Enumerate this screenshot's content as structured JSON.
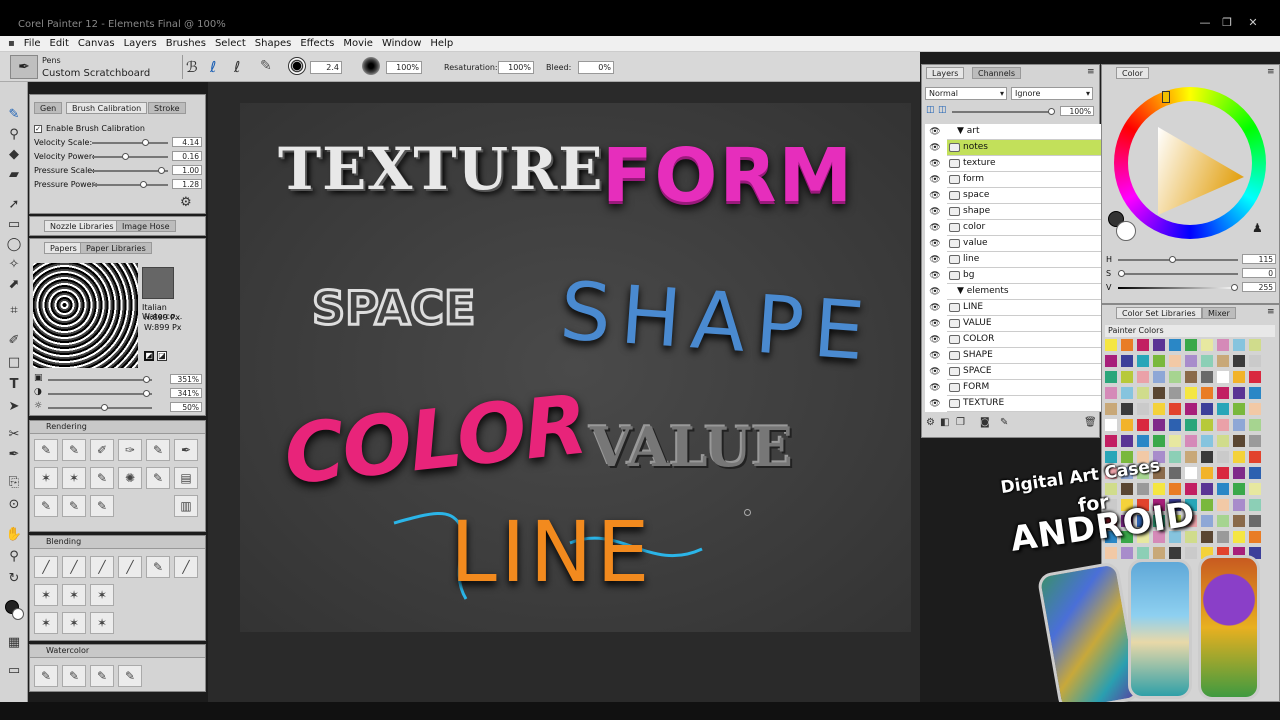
{
  "window": {
    "title": "Corel Painter 12 - Elements Final @ 100%",
    "min": "—",
    "max": "❐",
    "close": "✕"
  },
  "menu": [
    "File",
    "Edit",
    "Canvas",
    "Layers",
    "Brushes",
    "Select",
    "Shapes",
    "Effects",
    "Movie",
    "Window",
    "Help"
  ],
  "brush_selector": {
    "category": "Pens",
    "variant": "Custom Scratchboard"
  },
  "propbar": {
    "size": "2.4",
    "opacity": "100%",
    "resaturation_label": "Resaturation:",
    "resaturation": "100%",
    "bleed_label": "Bleed:",
    "bleed": "0%"
  },
  "brush_calibration": {
    "tabs": [
      "Gen",
      "Brush Calibration",
      "Stroke"
    ],
    "enable": "Enable Brush Calibration",
    "rows": [
      {
        "label": "Velocity Scale:",
        "value": "4.14",
        "pos": 0.72
      },
      {
        "label": "Velocity Power:",
        "value": "0.16",
        "pos": 0.43
      },
      {
        "label": "Pressure Scale:",
        "value": "1.00",
        "pos": 0.95
      },
      {
        "label": "Pressure Power:",
        "value": "1.28",
        "pos": 0.7
      }
    ]
  },
  "nozzle": {
    "tabs": [
      "Nozzle Libraries",
      "Image Hose"
    ]
  },
  "papers": {
    "tabs": [
      "Papers",
      "Paper Libraries"
    ],
    "name": "Italian Waterco...",
    "height": "H:899 Px",
    "width": "W:899 Px",
    "sliders": [
      {
        "value": "351%",
        "pos": 0.98
      },
      {
        "value": "341%",
        "pos": 0.98
      },
      {
        "value": "50%",
        "pos": 0.55
      }
    ]
  },
  "rendering": {
    "title": "Rendering"
  },
  "blending": {
    "title": "Blending"
  },
  "watercolor": {
    "title": "Watercolor"
  },
  "canvas_words": [
    "TEXTURE",
    "FORM",
    "SPACE",
    "SHAPE",
    "COLOR",
    "VALUE",
    "LINE"
  ],
  "layers": {
    "tabs": [
      "Layers",
      "Channels"
    ],
    "composite": "Normal",
    "depth": "Ignore",
    "opacity": "100%",
    "items": [
      {
        "name": "art",
        "group": true,
        "selected": false
      },
      {
        "name": "notes",
        "group": false,
        "selected": true
      },
      {
        "name": "texture",
        "group": false,
        "selected": false
      },
      {
        "name": "form",
        "group": false,
        "selected": false
      },
      {
        "name": "space",
        "group": false,
        "selected": false
      },
      {
        "name": "shape",
        "group": false,
        "selected": false
      },
      {
        "name": "color",
        "group": false,
        "selected": false
      },
      {
        "name": "value",
        "group": false,
        "selected": false
      },
      {
        "name": "line",
        "group": false,
        "selected": false
      },
      {
        "name": "bg",
        "group": false,
        "selected": false
      },
      {
        "name": "elements",
        "group": true,
        "selected": false
      },
      {
        "name": "LINE",
        "group": false,
        "selected": false
      },
      {
        "name": "VALUE",
        "group": false,
        "selected": false
      },
      {
        "name": "COLOR",
        "group": false,
        "selected": false
      },
      {
        "name": "SHAPE",
        "group": false,
        "selected": false
      },
      {
        "name": "SPACE",
        "group": false,
        "selected": false
      },
      {
        "name": "FORM",
        "group": false,
        "selected": false
      },
      {
        "name": "TEXTURE",
        "group": false,
        "selected": false
      }
    ]
  },
  "color": {
    "tab": "Color",
    "h": {
      "label": "H",
      "value": "115",
      "pos": 0.45
    },
    "s": {
      "label": "S",
      "value": "0",
      "pos": 0.0
    },
    "v": {
      "label": "V",
      "value": "255",
      "pos": 1.0
    }
  },
  "colorset": {
    "tabs": [
      "Color Set Libraries",
      "Mixer"
    ],
    "name": "Painter Colors"
  },
  "promo": {
    "line1": "Digital Art Cases",
    "line2": "for",
    "line3": "ANDROID"
  }
}
